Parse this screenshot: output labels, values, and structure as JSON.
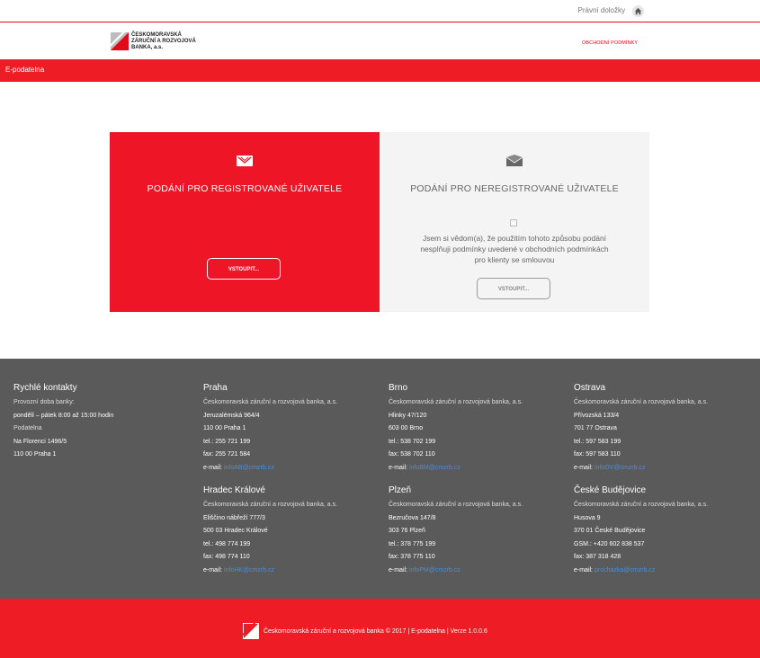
{
  "topbar": {
    "legal_label": "Právní doložky",
    "home_icon": "home-icon"
  },
  "header": {
    "logo_line1": "ČESKOMORAVSKÁ",
    "logo_line2": "ZÁRUČNÍ A ROZVOJOVÁ",
    "logo_line3": "BANKA, a.s.",
    "terms_link": "OBCHODNÍ PODMÍNKY"
  },
  "nav": {
    "title": "E-podatelna"
  },
  "panels": {
    "registered": {
      "title": "PODÁNÍ PRO REGISTROVANÉ UŽIVATELE",
      "button": "VSTOUPIT...",
      "icon": "envelope-open-icon"
    },
    "unregistered": {
      "title": "PODÁNÍ PRO NEREGISTROVANÉ UŽIVATELE",
      "consent_line1": "Jsem si vědom(a), že použitím tohoto způsobu podání",
      "consent_line2": "nesplňuji podmínky uvedené v obchodních podmínkách",
      "consent_line3": "pro klienty se smlouvou",
      "button": "VSTOUPIT...",
      "icon": "envelope-closed-icon"
    }
  },
  "footer": {
    "quick": {
      "heading": "Rychlé kontakty",
      "l1": "Provozní doba banky:",
      "l2": "pondělí – pátek 8:00 až 15:00 hodin",
      "l3": "Podatelna",
      "l4": "Na Florenci 1496/5",
      "l5": "110 00 Praha 1"
    },
    "praha": {
      "heading": "Praha",
      "bank": "Českomoravská záruční a rozvojová banka, a.s.",
      "street": "Jeruzalémská 964/4",
      "city": "110 00 Praha 1",
      "tel": "tel.: 255 721 199",
      "fax": "fax: 255 721 584",
      "email_label": "e-mail:",
      "email": "infoAB@cmzrb.cz"
    },
    "brno": {
      "heading": "Brno",
      "bank": "Českomoravská záruční a rozvojová banka, a.s.",
      "street": "Hlinky 47/120",
      "city": "603 00 Brno",
      "tel": "tel.: 538 702 199",
      "fax": "fax: 538 702 110",
      "email_label": "e-mail:",
      "email": "infoBM@cmzrb.cz"
    },
    "ostrava": {
      "heading": "Ostrava",
      "bank": "Českomoravská záruční a rozvojová banka, a.s.",
      "street": "Přívozská 133/4",
      "city": "701 77 Ostrava",
      "tel": "tel.: 597 583 199",
      "fax": "fax: 597 583 110",
      "email_label": "e-mail:",
      "email": "infoOV@cmzrb.cz"
    },
    "hradec": {
      "heading": "Hradec Králové",
      "bank": "Českomoravská záruční a rozvojová banka, a.s.",
      "street": "Eliščino nábřeží 777/3",
      "city": "500 03 Hradec Králové",
      "tel": "tel.: 498 774 199",
      "fax": "fax: 498 774 110",
      "email_label": "e-mail:",
      "email": "infoHK@cmzrb.cz"
    },
    "plzen": {
      "heading": "Plzeň",
      "bank": "Českomoravská záruční a rozvojová banka, a.s.",
      "street": "Bezručova 147/8",
      "city": "303 76 Plzeň",
      "tel": "tel.: 378 775 199",
      "fax": "fax: 378 775 110",
      "email_label": "e-mail:",
      "email": "infoPM@cmzrb.cz"
    },
    "budejovice": {
      "heading": "České Budějovice",
      "bank": "Českomoravská záruční a rozvojová banka, a.s.",
      "street": "Husova 9",
      "city": "370 01 České Budějovice",
      "tel": "GSM.: +420 602 838 537",
      "fax": "fax: 387 318 428",
      "email_label": "e-mail:",
      "email": "prochazka@cmzrb.cz"
    }
  },
  "bottom": {
    "copyright": "Českomoravská záruční a rozvojová banka © 2017 | E-podatelna | Verze 1.0.0.6"
  },
  "colors": {
    "brand_red": "#ee1c25",
    "footer_gray": "#5a5a5a",
    "panel_gray": "#f4f4f4",
    "link_blue": "#4a8fd8"
  }
}
